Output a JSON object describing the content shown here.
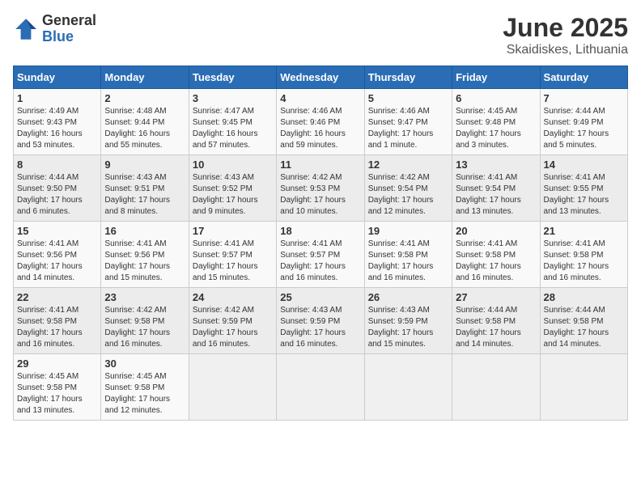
{
  "header": {
    "logo_general": "General",
    "logo_blue": "Blue",
    "month_title": "June 2025",
    "location": "Skaidiskes, Lithuania"
  },
  "weekdays": [
    "Sunday",
    "Monday",
    "Tuesday",
    "Wednesday",
    "Thursday",
    "Friday",
    "Saturday"
  ],
  "weeks": [
    [
      {
        "day": "1",
        "info": "Sunrise: 4:49 AM\nSunset: 9:43 PM\nDaylight: 16 hours\nand 53 minutes."
      },
      {
        "day": "2",
        "info": "Sunrise: 4:48 AM\nSunset: 9:44 PM\nDaylight: 16 hours\nand 55 minutes."
      },
      {
        "day": "3",
        "info": "Sunrise: 4:47 AM\nSunset: 9:45 PM\nDaylight: 16 hours\nand 57 minutes."
      },
      {
        "day": "4",
        "info": "Sunrise: 4:46 AM\nSunset: 9:46 PM\nDaylight: 16 hours\nand 59 minutes."
      },
      {
        "day": "5",
        "info": "Sunrise: 4:46 AM\nSunset: 9:47 PM\nDaylight: 17 hours\nand 1 minute."
      },
      {
        "day": "6",
        "info": "Sunrise: 4:45 AM\nSunset: 9:48 PM\nDaylight: 17 hours\nand 3 minutes."
      },
      {
        "day": "7",
        "info": "Sunrise: 4:44 AM\nSunset: 9:49 PM\nDaylight: 17 hours\nand 5 minutes."
      }
    ],
    [
      {
        "day": "8",
        "info": "Sunrise: 4:44 AM\nSunset: 9:50 PM\nDaylight: 17 hours\nand 6 minutes."
      },
      {
        "day": "9",
        "info": "Sunrise: 4:43 AM\nSunset: 9:51 PM\nDaylight: 17 hours\nand 8 minutes."
      },
      {
        "day": "10",
        "info": "Sunrise: 4:43 AM\nSunset: 9:52 PM\nDaylight: 17 hours\nand 9 minutes."
      },
      {
        "day": "11",
        "info": "Sunrise: 4:42 AM\nSunset: 9:53 PM\nDaylight: 17 hours\nand 10 minutes."
      },
      {
        "day": "12",
        "info": "Sunrise: 4:42 AM\nSunset: 9:54 PM\nDaylight: 17 hours\nand 12 minutes."
      },
      {
        "day": "13",
        "info": "Sunrise: 4:41 AM\nSunset: 9:54 PM\nDaylight: 17 hours\nand 13 minutes."
      },
      {
        "day": "14",
        "info": "Sunrise: 4:41 AM\nSunset: 9:55 PM\nDaylight: 17 hours\nand 13 minutes."
      }
    ],
    [
      {
        "day": "15",
        "info": "Sunrise: 4:41 AM\nSunset: 9:56 PM\nDaylight: 17 hours\nand 14 minutes."
      },
      {
        "day": "16",
        "info": "Sunrise: 4:41 AM\nSunset: 9:56 PM\nDaylight: 17 hours\nand 15 minutes."
      },
      {
        "day": "17",
        "info": "Sunrise: 4:41 AM\nSunset: 9:57 PM\nDaylight: 17 hours\nand 15 minutes."
      },
      {
        "day": "18",
        "info": "Sunrise: 4:41 AM\nSunset: 9:57 PM\nDaylight: 17 hours\nand 16 minutes."
      },
      {
        "day": "19",
        "info": "Sunrise: 4:41 AM\nSunset: 9:58 PM\nDaylight: 17 hours\nand 16 minutes."
      },
      {
        "day": "20",
        "info": "Sunrise: 4:41 AM\nSunset: 9:58 PM\nDaylight: 17 hours\nand 16 minutes."
      },
      {
        "day": "21",
        "info": "Sunrise: 4:41 AM\nSunset: 9:58 PM\nDaylight: 17 hours\nand 16 minutes."
      }
    ],
    [
      {
        "day": "22",
        "info": "Sunrise: 4:41 AM\nSunset: 9:58 PM\nDaylight: 17 hours\nand 16 minutes."
      },
      {
        "day": "23",
        "info": "Sunrise: 4:42 AM\nSunset: 9:58 PM\nDaylight: 17 hours\nand 16 minutes."
      },
      {
        "day": "24",
        "info": "Sunrise: 4:42 AM\nSunset: 9:59 PM\nDaylight: 17 hours\nand 16 minutes."
      },
      {
        "day": "25",
        "info": "Sunrise: 4:43 AM\nSunset: 9:59 PM\nDaylight: 17 hours\nand 16 minutes."
      },
      {
        "day": "26",
        "info": "Sunrise: 4:43 AM\nSunset: 9:59 PM\nDaylight: 17 hours\nand 15 minutes."
      },
      {
        "day": "27",
        "info": "Sunrise: 4:44 AM\nSunset: 9:58 PM\nDaylight: 17 hours\nand 14 minutes."
      },
      {
        "day": "28",
        "info": "Sunrise: 4:44 AM\nSunset: 9:58 PM\nDaylight: 17 hours\nand 14 minutes."
      }
    ],
    [
      {
        "day": "29",
        "info": "Sunrise: 4:45 AM\nSunset: 9:58 PM\nDaylight: 17 hours\nand 13 minutes."
      },
      {
        "day": "30",
        "info": "Sunrise: 4:45 AM\nSunset: 9:58 PM\nDaylight: 17 hours\nand 12 minutes."
      },
      {
        "day": "",
        "info": ""
      },
      {
        "day": "",
        "info": ""
      },
      {
        "day": "",
        "info": ""
      },
      {
        "day": "",
        "info": ""
      },
      {
        "day": "",
        "info": ""
      }
    ]
  ]
}
